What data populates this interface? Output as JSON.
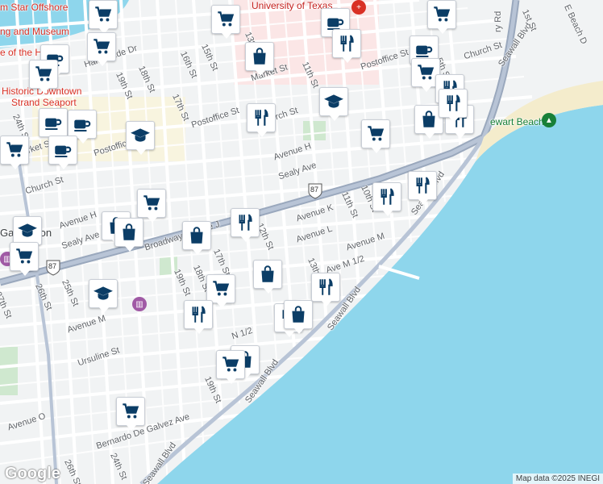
{
  "streets": {
    "harborside": "Harborside Dr",
    "s19": "19th St",
    "s18": "18th St",
    "s16": "16th St",
    "s15": "15th St",
    "s13": "13th St",
    "s11": "11th St",
    "s10": "10th St",
    "s17": "17th St",
    "s24": "24th St",
    "s25": "25th St",
    "s26": "26th St",
    "s27": "27th St",
    "market1": "Market St",
    "market2": "Market St",
    "postoffice1": "Postoffice St",
    "postoffice2": "Postoffice St",
    "postoffice3": "Postoffice",
    "church1": "Church St",
    "church2": "Church St",
    "church3": "rch St",
    "avh1": "Avenue H",
    "avh2": "Avenue H",
    "sealy1": "Sealy Ave",
    "sealy2": "Sealy Ave",
    "avk": "Avenue K",
    "avl": "Avenue L",
    "avm1": "Avenue M",
    "avm2": "Avenue M",
    "avm12": "Ave M 1/2",
    "avn12": "N 1/2",
    "ursuline": "Ursuline St",
    "aveo": "Avenue O",
    "bernardo": "Bernardo De Galvez Ave",
    "seawall1": "Seawall Blvd",
    "seawall2": "Seawall Blvd",
    "seawall3": "Seawall Blvd",
    "seawall4": "Seawall Blvd",
    "seawall5": "Seawall Blvd",
    "broadway": "Broadway Avenue J",
    "ferry": "ry Rd",
    "st1": "1st St",
    "ebeach": "E Beach D",
    "s5": "5th St",
    "hw87a": "87",
    "hw87b": "87",
    "s13b": "13th St",
    "s12": "12th St",
    "s17b": "17th St",
    "s18b": "18th St",
    "s19b": "19th St",
    "s19c": "19th St",
    "s24b": "24th St",
    "s26b": "26th St",
    "s25b": "25th St"
  },
  "places": {
    "university": "University of Texas",
    "offshore1": "m Star Offshore",
    "offshore2": "ng and Museum",
    "offshore3": "e of the Histori",
    "historic1": "Historic Downtown",
    "historic2": "Strand Seaport",
    "stewart": "ewart Beach",
    "galveston": "Ga",
    "galveston2": "ton"
  },
  "pins": [
    {
      "icon": "shopping-cart-icon"
    },
    {
      "icon": "shopping-cart-icon"
    },
    {
      "icon": "shopping-cart-icon"
    },
    {
      "icon": "cafe-icon"
    },
    {
      "icon": "shopping-cart-icon"
    },
    {
      "icon": "shopping-bag-icon"
    },
    {
      "icon": "cafe-icon"
    },
    {
      "icon": "restaurant-icon"
    },
    {
      "icon": "cafe-icon"
    },
    {
      "icon": "shopping-cart-icon"
    },
    {
      "icon": "shopping-cart-icon"
    },
    {
      "icon": "restaurant-icon"
    },
    {
      "icon": "school-icon"
    },
    {
      "icon": "restaurant-icon"
    },
    {
      "icon": "cafe-icon"
    },
    {
      "icon": "cafe-icon"
    },
    {
      "icon": "school-icon"
    },
    {
      "icon": "shopping-cart-icon"
    },
    {
      "icon": "shopping-bag-icon"
    },
    {
      "icon": "restaurant-icon"
    },
    {
      "icon": "cafe-icon"
    },
    {
      "icon": "shopping-cart-icon"
    },
    {
      "icon": "restaurant-icon"
    },
    {
      "icon": "restaurant-icon"
    },
    {
      "icon": "restaurant-icon"
    },
    {
      "icon": "shopping-cart-icon"
    },
    {
      "icon": "shopping-bag-icon"
    },
    {
      "icon": "shopping-bag-icon"
    },
    {
      "icon": "shopping-bag-icon"
    },
    {
      "icon": "restaurant-icon"
    },
    {
      "icon": "school-icon"
    },
    {
      "icon": "shopping-cart-icon"
    },
    {
      "icon": "school-icon"
    },
    {
      "icon": "shopping-cart-icon"
    },
    {
      "icon": "shopping-bag-icon"
    },
    {
      "icon": "restaurant-icon"
    },
    {
      "icon": "restaurant-icon"
    },
    {
      "icon": "shopping-bag-icon"
    },
    {
      "icon": "restaurant-icon"
    },
    {
      "icon": "shopping-bag-icon"
    },
    {
      "icon": "shopping-cart-icon"
    },
    {
      "icon": "shopping-cart-icon"
    }
  ],
  "logo": "Google",
  "attribution": "Map data ©2025 INEGI",
  "colors": {
    "land": "#f1f3f4",
    "water": "#8ed6ec",
    "highway": "#9aa8bd",
    "pin_icon": "#0b3d66",
    "campus": "#fbe6e6",
    "park": "#cfe8cf"
  }
}
